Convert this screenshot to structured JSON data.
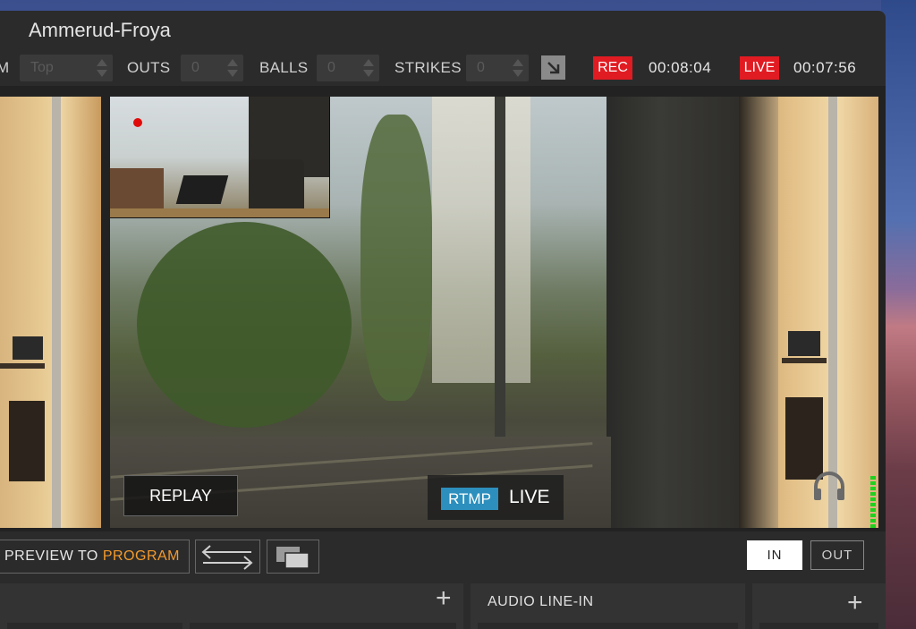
{
  "window": {
    "title": "Ammerud-Froya"
  },
  "toolbar": {
    "cut_label": "M",
    "inning_value": "Top",
    "outs_label": "OUTS",
    "outs_value": "0",
    "balls_label": "BALLS",
    "balls_value": "0",
    "strikes_label": "STRIKES",
    "strikes_value": "0",
    "rec_label": "REC",
    "rec_timer": "00:08:04",
    "live_label": "LIVE",
    "live_timer": "00:07:56"
  },
  "program": {
    "replay_label": "REPLAY",
    "rtmp_label": "RTMP",
    "live_label": "LIVE"
  },
  "transition": {
    "preview_to": "PREVIEW TO",
    "program": "PROGRAM",
    "in_label": "IN",
    "out_label": "OUT"
  },
  "panels": {
    "audio_line_in": "AUDIO LINE-IN",
    "plus_symbol": "+"
  },
  "colors": {
    "rec": "#e11b22",
    "rtmp": "#2c8fbd",
    "program_accent": "#f39a2c",
    "meter": "#1fd11f"
  }
}
